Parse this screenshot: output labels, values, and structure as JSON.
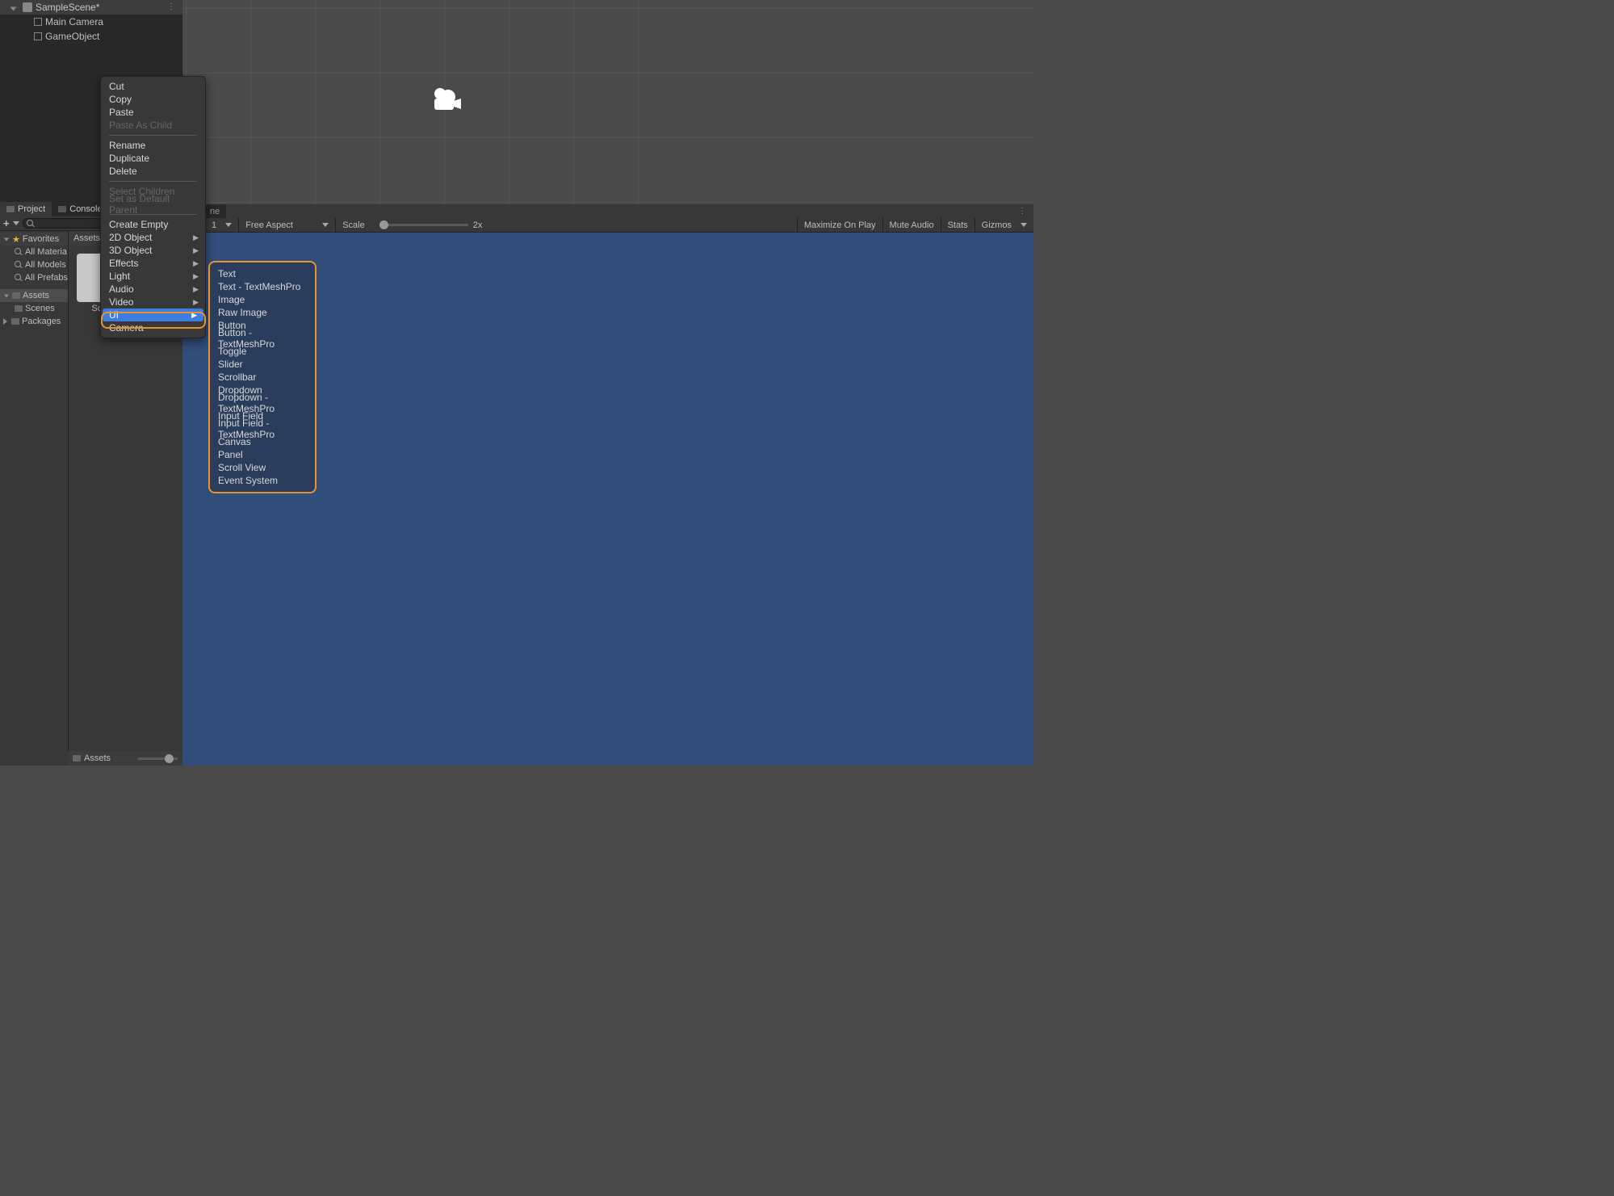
{
  "hierarchy": {
    "scene": "SampleScene*",
    "items": [
      "Main Camera",
      "GameObject"
    ]
  },
  "project": {
    "tabs": [
      "Project",
      "Console"
    ],
    "breadcrumb": "Assets",
    "favorites_label": "Favorites",
    "favorites": [
      "All Materia",
      "All Models",
      "All Prefabs"
    ],
    "assets_label": "Assets",
    "assets_children": [
      "Scenes"
    ],
    "packages_label": "Packages",
    "grid_item": "Scen",
    "footer": "Assets"
  },
  "game_toolbar": {
    "display_dropdown": "1",
    "aspect": "Free Aspect",
    "scale_label": "Scale",
    "scale_value": "2x",
    "right": [
      "Maximize On Play",
      "Mute Audio",
      "Stats",
      "Gizmos"
    ]
  },
  "game_tab_truncated": "ne",
  "context_menu": {
    "group1": [
      "Cut",
      "Copy",
      "Paste"
    ],
    "group1_disabled": [
      "Paste As Child"
    ],
    "group2": [
      "Rename",
      "Duplicate",
      "Delete"
    ],
    "group3_disabled": [
      "Select Children",
      "Set as Default Parent"
    ],
    "group4_plain": [
      "Create Empty"
    ],
    "group4_submenu": [
      "2D Object",
      "3D Object",
      "Effects",
      "Light",
      "Audio",
      "Video",
      "UI"
    ],
    "group4_last": [
      "Camera"
    ]
  },
  "submenu_ui": [
    "Text",
    "Text - TextMeshPro",
    "Image",
    "Raw Image",
    "Button",
    "Button - TextMeshPro",
    "Toggle",
    "Slider",
    "Scrollbar",
    "Dropdown",
    "Dropdown - TextMeshPro",
    "Input Field",
    "Input Field - TextMeshPro",
    "Canvas",
    "Panel",
    "Scroll View",
    "Event System"
  ]
}
